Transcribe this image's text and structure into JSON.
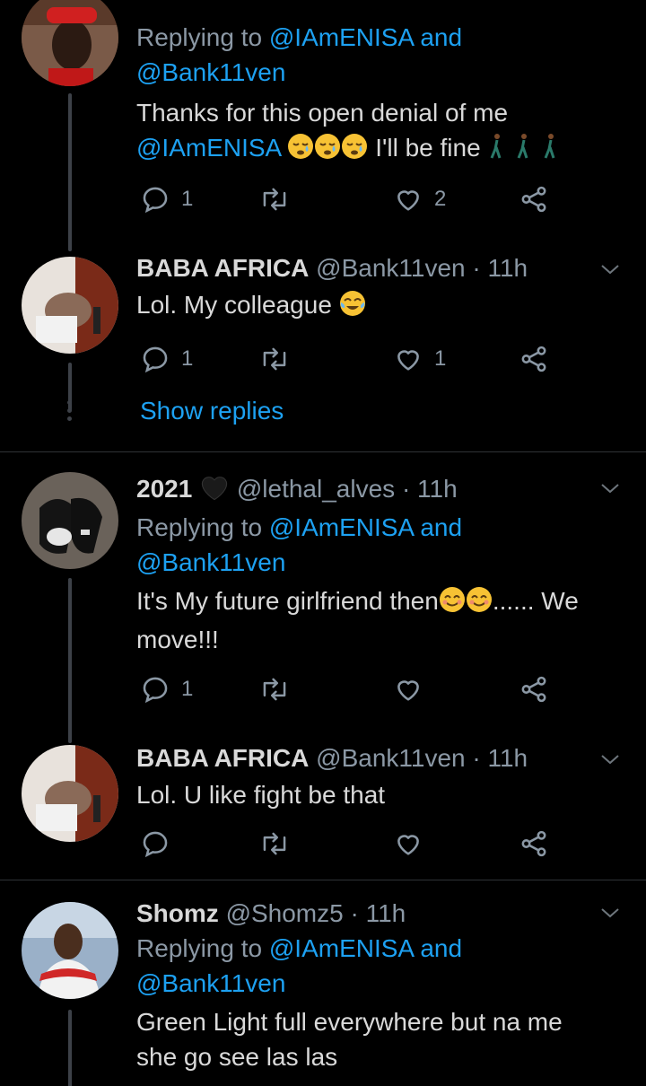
{
  "replying_prefix": "Replying to",
  "show_replies": "Show replies",
  "tweets": [
    {
      "reply_to_1": "@IAmENISA",
      "reply_and": "and",
      "reply_to_2": "@Bank11ven",
      "text_line1": "Thanks for this open denial of me",
      "text_mention": "@IAmENISA",
      "text_tail": "I'll be fine",
      "reply_count": "1",
      "like_count": "2"
    },
    {
      "name": "BABA AFRICA",
      "meta": "@Bank11ven · 11h",
      "text": "Lol. My colleague",
      "reply_count": "1",
      "like_count": "1"
    },
    {
      "name": "2021",
      "meta": "@lethal_alves · 11h",
      "reply_to_1": "@IAmENISA",
      "reply_and": "and",
      "reply_to_2": "@Bank11ven",
      "text_line1": "It's My future girlfriend then",
      "text_line1_tail": "...... We",
      "text_line2": "move!!!",
      "reply_count": "1"
    },
    {
      "name": "BABA AFRICA",
      "meta": "@Bank11ven · 11h",
      "text": "Lol. U like fight be that"
    },
    {
      "name": "Shomz",
      "meta": "@Shomz5 · 11h",
      "reply_to_1": "@IAmENISA",
      "reply_and": "and",
      "reply_to_2": "@Bank11ven",
      "text_line1": "Green Light full everywhere but na me",
      "text_line2": "she go see las las"
    }
  ],
  "colors": {
    "background": "#000000",
    "link": "#1da1f2",
    "muted": "#8b98a5",
    "text": "#d9d9d9",
    "divider": "#2f3336"
  }
}
